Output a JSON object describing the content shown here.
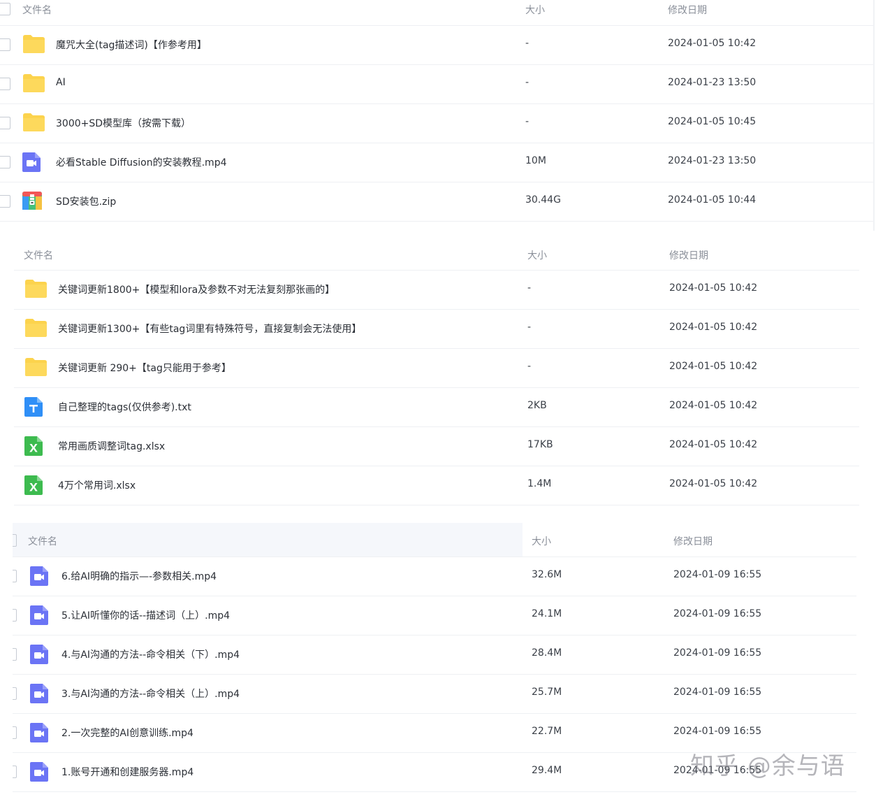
{
  "headers": {
    "name": "文件名",
    "size": "大小",
    "date": "修改日期"
  },
  "panel1": {
    "rows": [
      {
        "icon": "folder",
        "name": "魔咒大全(tag描述词)【作参考用】",
        "size": "-",
        "date": "2024-01-05 10:42"
      },
      {
        "icon": "folder",
        "name": "AI",
        "size": "-",
        "date": "2024-01-23 13:50"
      },
      {
        "icon": "folder",
        "name": "3000+SD模型库（按需下载）",
        "size": "-",
        "date": "2024-01-05 10:45"
      },
      {
        "icon": "video",
        "name": "必看Stable Diffusion的安装教程.mp4",
        "size": "10M",
        "date": "2024-01-23 13:50"
      },
      {
        "icon": "zip",
        "name": "SD安装包.zip",
        "size": "30.44G",
        "date": "2024-01-05 10:44"
      }
    ]
  },
  "panel2": {
    "rows": [
      {
        "icon": "folder",
        "name": "关键词更新1800+【模型和lora及参数不对无法复刻那张画的】",
        "size": "-",
        "date": "2024-01-05 10:42"
      },
      {
        "icon": "folder",
        "name": "关键词更新1300+【有些tag词里有特殊符号，直接复制会无法使用】",
        "size": "-",
        "date": "2024-01-05 10:42"
      },
      {
        "icon": "folder",
        "name": "关键词更新 290+【tag只能用于参考】",
        "size": "-",
        "date": "2024-01-05 10:42"
      },
      {
        "icon": "text",
        "name": "自己整理的tags(仅供参考).txt",
        "size": "2KB",
        "date": "2024-01-05 10:42"
      },
      {
        "icon": "excel",
        "name": "常用画质调整词tag.xlsx",
        "size": "17KB",
        "date": "2024-01-05 10:42"
      },
      {
        "icon": "excel",
        "name": "4万个常用词.xlsx",
        "size": "1.4M",
        "date": "2024-01-05 10:42"
      }
    ]
  },
  "panel3": {
    "rows": [
      {
        "icon": "video",
        "name": "6.给AI明确的指示—-参数相关.mp4",
        "size": "32.6M",
        "date": "2024-01-09 16:55"
      },
      {
        "icon": "video",
        "name": "5.让AI听懂你的话--描述词（上）.mp4",
        "size": "24.1M",
        "date": "2024-01-09 16:55"
      },
      {
        "icon": "video",
        "name": "4.与AI沟通的方法--命令相关（下）.mp4",
        "size": "28.4M",
        "date": "2024-01-09 16:55"
      },
      {
        "icon": "video",
        "name": "3.与AI沟通的方法--命令相关（上）.mp4",
        "size": "25.7M",
        "date": "2024-01-09 16:55"
      },
      {
        "icon": "video",
        "name": "2.一次完整的AI创意训练.mp4",
        "size": "22.7M",
        "date": "2024-01-09 16:55"
      },
      {
        "icon": "video",
        "name": "1.账号开通和创建服务器.mp4",
        "size": "29.4M",
        "date": "2024-01-09 16:55"
      }
    ]
  },
  "watermark": "知乎 @余与语",
  "colors": {
    "folder": "#fcd34d",
    "video": "#6b74f5",
    "text": "#2f8ff7",
    "excel": "#3dbb4f",
    "zip_red": "#f25757",
    "zip_blue": "#3a9bf3",
    "zip_yellow": "#f5c242",
    "zip_green": "#46c07a"
  }
}
